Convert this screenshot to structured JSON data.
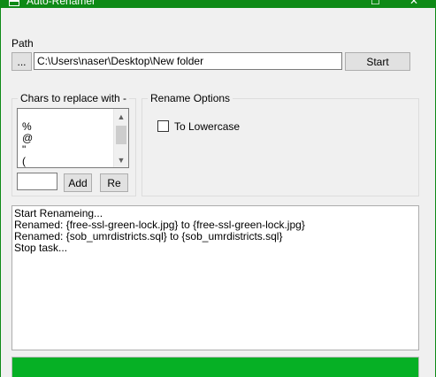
{
  "window": {
    "title": "Auto-Renamer",
    "maximize_glyph": "☐",
    "close_glyph": "✕"
  },
  "path": {
    "label": "Path",
    "browse_label": "...",
    "value": "C:\\Users\\naser\\Desktop\\New folder",
    "start_label": "Start"
  },
  "chars_group": {
    "title": "Chars to replace with -",
    "items": [
      "%",
      "@",
      "\"",
      "("
    ],
    "add_input_value": "",
    "add_label": "Add",
    "remove_label": "Re"
  },
  "rename_options": {
    "title": "Rename Options",
    "lowercase_label": "To Lowercase",
    "lowercase_checked": false
  },
  "log": {
    "lines": [
      "Start Renameing...",
      "Renamed: {free-ssl-green-lock.jpg} to {free-ssl-green-lock.jpg}",
      "Renamed: {sob_umrdistricts.sql} to {sob_umrdistricts.sql}",
      "Stop task..."
    ]
  },
  "progress": {
    "percent": 100,
    "color": "#06b025"
  },
  "colors": {
    "titlebar": "#0e8a16",
    "window_bg": "#f0f0f0"
  }
}
